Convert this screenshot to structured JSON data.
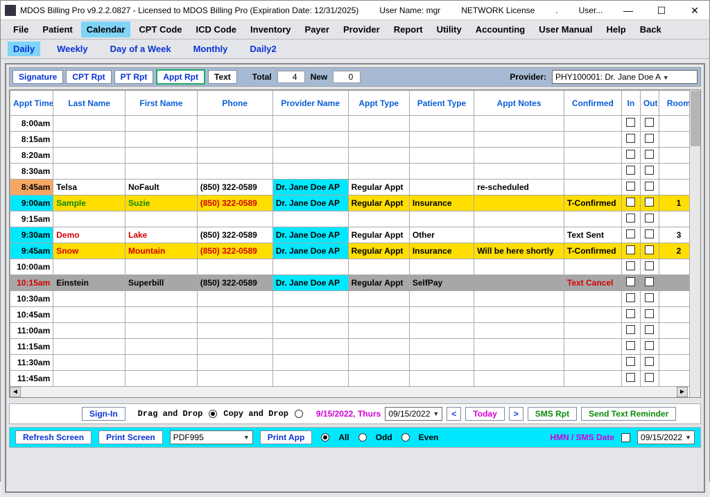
{
  "titlebar": {
    "app_title": "MDOS Billing Pro v9.2.2.0827 - Licensed to MDOS Billing Pro (Expiration Date: 12/31/2025)",
    "user_label": "User Name: mgr",
    "license": "NETWORK License",
    "dot": ".",
    "user_menu": "User..."
  },
  "menu": [
    "File",
    "Patient",
    "Calendar",
    "CPT Code",
    "ICD Code",
    "Inventory",
    "Payer",
    "Provider",
    "Report",
    "Utility",
    "Accounting",
    "User Manual",
    "Help",
    "Back"
  ],
  "submenu": [
    "Daily",
    "Weekly",
    "Day of a Week",
    "Monthly",
    "Daily2"
  ],
  "toolbar": {
    "signature": "Signature",
    "cpt": "CPT Rpt",
    "pt": "PT Rpt",
    "appt": "Appt Rpt",
    "text": "Text",
    "total_lbl": "Total",
    "total_val": "4",
    "new_lbl": "New",
    "new_val": "0",
    "provider_lbl": "Provider:",
    "provider_val": "PHY100001: Dr. Jane Doe A"
  },
  "columns": {
    "time": "Appt Time",
    "last": "Last Name",
    "first": "First Name",
    "phone": "Phone",
    "prov": "Provider Name",
    "atype": "Appt Type",
    "ptype": "Patient Type",
    "notes": "Appt Notes",
    "conf": "Confirmed",
    "in": "In",
    "out": "Out",
    "room": "Room"
  },
  "rows": [
    {
      "time": "8:00am"
    },
    {
      "time": "8:15am"
    },
    {
      "time": "8:20am"
    },
    {
      "time": "8:30am"
    },
    {
      "time": "8:45am",
      "time_bg": "orange",
      "last": "Telsa",
      "first": "NoFault",
      "phone": "(850) 322-0589",
      "prov": "Dr. Jane Doe AP",
      "prov_cyan": true,
      "atype": "Regular Appt",
      "notes": "re-scheduled"
    },
    {
      "time": "9:00am",
      "time_bg": "cyan",
      "row_bg": "yellow",
      "last": "Sample",
      "last_cls": "txt-grn",
      "first": "Suzie",
      "first_cls": "txt-grn",
      "phone": "(850) 322-0589",
      "phone_cls": "txt-red",
      "prov": "Dr. Jane Doe AP",
      "prov_cyan": true,
      "atype": "Regular Appt",
      "ptype": "Insurance",
      "conf": "T-Confirmed",
      "room": "1"
    },
    {
      "time": "9:15am"
    },
    {
      "time": "9:30am",
      "time_bg": "cyan",
      "last": "Demo",
      "last_cls": "txt-red",
      "first": "Lake",
      "first_cls": "txt-red",
      "phone": "(850) 322-0589",
      "prov": "Dr. Jane Doe AP",
      "prov_cyan": true,
      "atype": "Regular Appt",
      "ptype": "Other",
      "conf": "Text Sent",
      "room": "3"
    },
    {
      "time": "9:45am",
      "time_bg": "cyan",
      "row_bg": "yellow",
      "last": "Snow",
      "last_cls": "txt-red",
      "first": "Mountain",
      "first_cls": "txt-red",
      "phone": "(850) 322-0589",
      "phone_cls": "txt-red",
      "prov": "Dr. Jane Doe AP",
      "prov_cyan": true,
      "atype": "Regular Appt",
      "ptype": "Insurance",
      "notes": "Will be here shortly",
      "conf": "T-Confirmed",
      "room": "2"
    },
    {
      "time": "10:00am"
    },
    {
      "time": "10:15am",
      "row_bg": "gray",
      "time_cls": "txt-red",
      "last": "Einstein",
      "first": "Superbill",
      "phone": "(850) 322-0589",
      "prov": "Dr. Jane Doe AP",
      "prov_cyan": true,
      "atype": "Regular Appt",
      "ptype": "SelfPay",
      "conf": "Text Cancel",
      "conf_cls": "txt-red"
    },
    {
      "time": "10:30am"
    },
    {
      "time": "10:45am"
    },
    {
      "time": "11:00am"
    },
    {
      "time": "11:15am"
    },
    {
      "time": "11:30am"
    },
    {
      "time": "11:45am"
    }
  ],
  "bottom1": {
    "signin": "Sign-In",
    "drag": "Drag and Drop",
    "copy": "Copy and Drop",
    "date_long": "9/15/2022, Thurs",
    "date_short": "09/15/2022",
    "lt": "<",
    "today": "Today",
    "gt": ">",
    "sms": "SMS Rpt",
    "send": "Send Text Reminder"
  },
  "bottom2": {
    "refresh": "Refresh Screen",
    "print_screen": "Print Screen",
    "printer": "PDF995",
    "print_app": "Print App",
    "all": "All",
    "odd": "Odd",
    "even": "Even",
    "sms_date_lbl": "HMN / SMS Date",
    "date": "09/15/2022"
  }
}
